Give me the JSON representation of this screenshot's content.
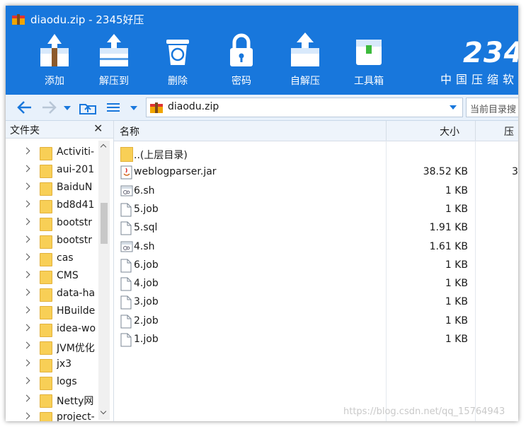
{
  "window": {
    "title": "diaodu.zip - 2345好压"
  },
  "toolbar": [
    {
      "label": "添加",
      "icon": "add-archive-icon"
    },
    {
      "label": "解压到",
      "icon": "extract-to-icon"
    },
    {
      "label": "删除",
      "icon": "delete-icon"
    },
    {
      "label": "密码",
      "icon": "password-lock-icon"
    },
    {
      "label": "自解压",
      "icon": "self-extract-icon"
    },
    {
      "label": "工具箱",
      "icon": "toolbox-icon"
    }
  ],
  "brand": {
    "text": "234",
    "subtitle": "中国压缩软件"
  },
  "address": {
    "path": "diaodu.zip",
    "search_placeholder": "当前目录搜"
  },
  "folder_pane": {
    "title": "文件夹",
    "items": [
      "Activiti-",
      "aui-201",
      "BaiduN",
      "bd8d41",
      "bootstr",
      "bootstr",
      "cas",
      "CMS",
      "data-ha",
      "HBuilde",
      "idea-wo",
      "JVM优化",
      "jx3",
      "logs",
      "Netty网",
      "project-"
    ]
  },
  "columns": {
    "name": "名称",
    "size": "大小",
    "compressed": "压"
  },
  "files": [
    {
      "name": "..(上层目录)",
      "size": "",
      "compressed": "",
      "icon": "folder-icon"
    },
    {
      "name": "weblogparser.jar",
      "size": "38.52 KB",
      "compressed": "3",
      "icon": "jar-file-icon"
    },
    {
      "name": "6.sh",
      "size": "1 KB",
      "compressed": "",
      "icon": "script-file-icon"
    },
    {
      "name": "5.job",
      "size": "1 KB",
      "compressed": "",
      "icon": "file-icon"
    },
    {
      "name": "5.sql",
      "size": "1.91 KB",
      "compressed": "",
      "icon": "file-icon"
    },
    {
      "name": "4.sh",
      "size": "1.61 KB",
      "compressed": "",
      "icon": "script-file-icon"
    },
    {
      "name": "6.job",
      "size": "1 KB",
      "compressed": "",
      "icon": "file-icon"
    },
    {
      "name": "4.job",
      "size": "1 KB",
      "compressed": "",
      "icon": "file-icon"
    },
    {
      "name": "3.job",
      "size": "1 KB",
      "compressed": "",
      "icon": "file-icon"
    },
    {
      "name": "2.job",
      "size": "1 KB",
      "compressed": "",
      "icon": "file-icon"
    },
    {
      "name": "1.job",
      "size": "1 KB",
      "compressed": "",
      "icon": "file-icon"
    }
  ],
  "watermark": "https://blog.csdn.net/qq_15764943",
  "colors": {
    "header": "#1877dc",
    "accent": "#1877dc"
  }
}
